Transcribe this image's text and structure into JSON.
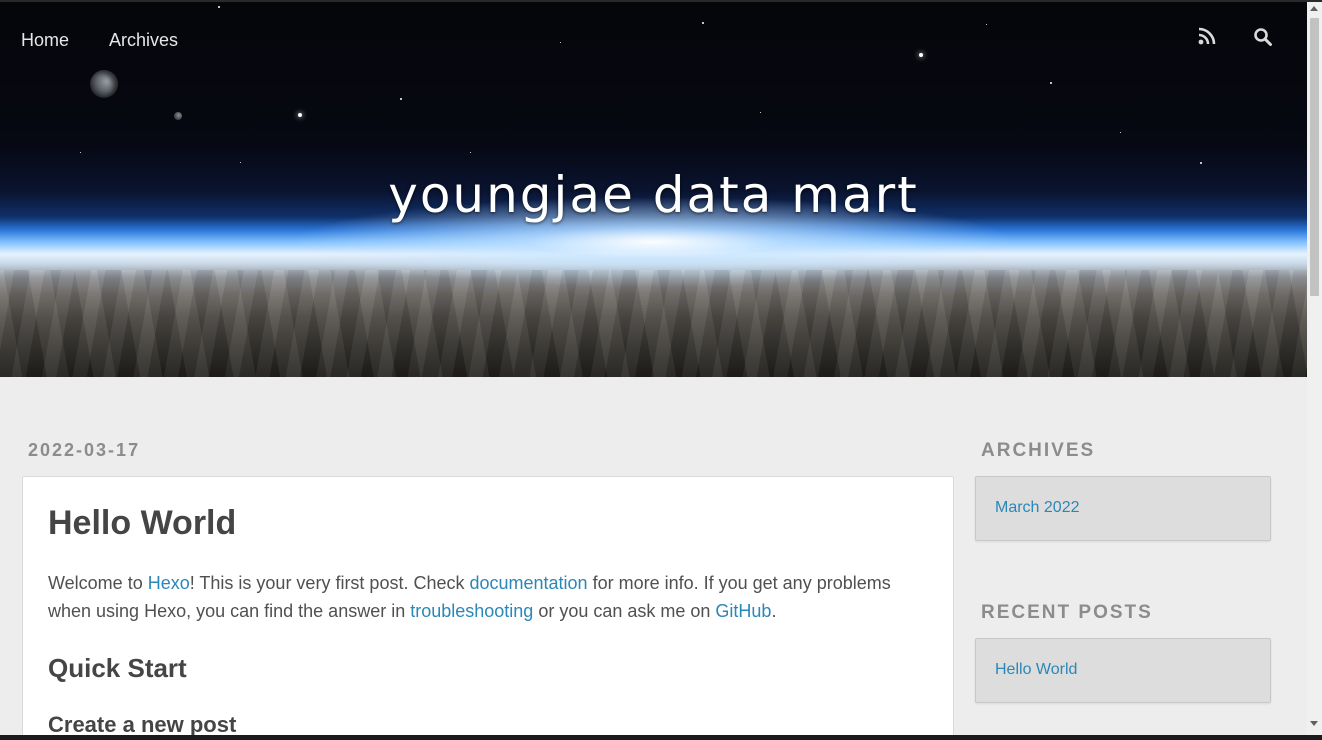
{
  "nav": {
    "home_label": "Home",
    "archives_label": "Archives",
    "rss_icon": "rss-icon",
    "search_icon": "search-icon"
  },
  "banner": {
    "site_title": "youngjae data mart"
  },
  "post": {
    "date": "2022-03-17",
    "title": "Hello World",
    "intro": {
      "part1": "Welcome to ",
      "link_hexo": "Hexo",
      "part2": "! This is your very first post. Check ",
      "link_documentation": "documentation",
      "part3": " for more info. If you get any problems when using Hexo, you can find the answer in ",
      "link_troubleshooting": "troubleshooting",
      "part4": " or you can ask me on ",
      "link_github": "GitHub",
      "part5": "."
    },
    "heading_quick_start": "Quick Start",
    "heading_create_post": "Create a new post"
  },
  "sidebar": {
    "archives_title": "ARCHIVES",
    "archives_items": [
      "March 2022"
    ],
    "recent_title": "RECENT POSTS",
    "recent_items": [
      "Hello World"
    ]
  },
  "colors": {
    "link": "#2b87b8",
    "main_bg": "#ededed",
    "widget_title": "#8c8c8c"
  }
}
